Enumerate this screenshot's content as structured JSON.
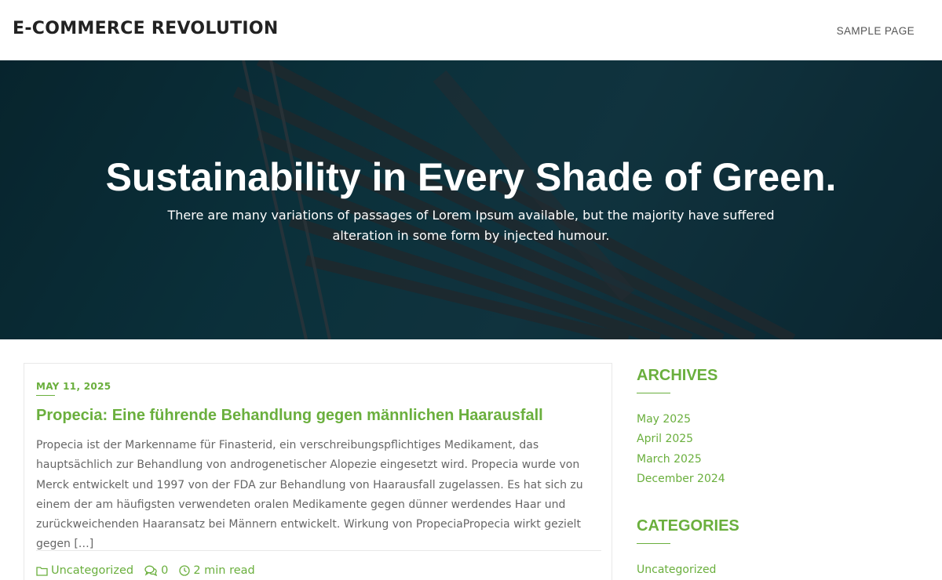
{
  "header": {
    "site_title": "E-COMMERCE REVOLUTION",
    "nav": [
      {
        "label": "SAMPLE PAGE"
      }
    ]
  },
  "hero": {
    "title": "Sustainability in Every Shade of Green.",
    "subtitle": "There are many variations of passages of Lorem Ipsum available, but the majority have suffered alteration in some form by injected humour."
  },
  "post": {
    "date": "MAY 11, 2025",
    "title": "Propecia: Eine führende Behandlung gegen männlichen Haarausfall",
    "excerpt": "Propecia ist der Markenname für Finasterid, ein verschreibungspflichtiges Medikament, das hauptsächlich zur Behandlung von androgenetischer Alopezie eingesetzt wird. Propecia wurde von Merck entwickelt und 1997 von der FDA zur Behandlung von Haarausfall zugelassen. Es hat sich zu einem der am häufigsten verwendeten oralen Medikamente gegen dünner werdendes Haar und zurückweichenden Haaransatz bei Männern entwickelt. Wirkung von PropeciaPropecia wirkt gezielt gegen […]",
    "category": "Uncategorized",
    "comments": "0",
    "read_time": "2 min read"
  },
  "sidebar": {
    "archives": {
      "title": "ARCHIVES",
      "items": [
        {
          "label": "May 2025"
        },
        {
          "label": "April 2025"
        },
        {
          "label": "March 2025"
        },
        {
          "label": "December 2024"
        }
      ]
    },
    "categories": {
      "title": "CATEGORIES",
      "items": [
        {
          "label": "Uncategorized"
        }
      ]
    }
  },
  "colors": {
    "accent": "#6aaf3d",
    "hero_bg": "#0f3a45"
  }
}
